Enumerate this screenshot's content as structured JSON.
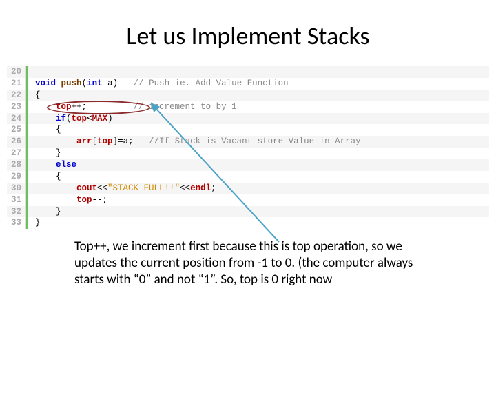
{
  "title": "Let us Implement Stacks",
  "code": {
    "lines": [
      {
        "n": "20",
        "html": ""
      },
      {
        "n": "21",
        "html": "<span class='kw'>void</span> <span class='fn'>push</span>(<span class='kw'>int</span> a)   <span class='cmt'>// Push ie. Add Value Function</span>"
      },
      {
        "n": "22",
        "html": "{"
      },
      {
        "n": "23",
        "html": "    <span class='var'>top</span>++;         <span class='cmt'>// increment to by 1</span>"
      },
      {
        "n": "24",
        "html": "    <span class='kw'>if</span>(<span class='var'>top</span>&lt;<span class='var'>MAX</span>)"
      },
      {
        "n": "25",
        "html": "    {"
      },
      {
        "n": "26",
        "html": "        <span class='var'>arr</span>[<span class='var'>top</span>]=a;   <span class='cmt'>//If Stack is Vacant store Value in Array</span>"
      },
      {
        "n": "27",
        "html": "    }"
      },
      {
        "n": "28",
        "html": "    <span class='kw'>else</span>"
      },
      {
        "n": "29",
        "html": "    {"
      },
      {
        "n": "30",
        "html": "        <span class='var'>cout</span>&lt;&lt;<span class='str'>\"STACK FULL!!\"</span>&lt;&lt;<span class='var'>endl</span>;"
      },
      {
        "n": "31",
        "html": "        <span class='var'>top</span>--;"
      },
      {
        "n": "32",
        "html": "    }"
      },
      {
        "n": "33",
        "html": "}"
      }
    ]
  },
  "explain": "Top++, we increment first because this is top operation, so we updates the current position from -1 to 0. (the computer always starts with “0” and not “1”. So, top is 0 right now"
}
